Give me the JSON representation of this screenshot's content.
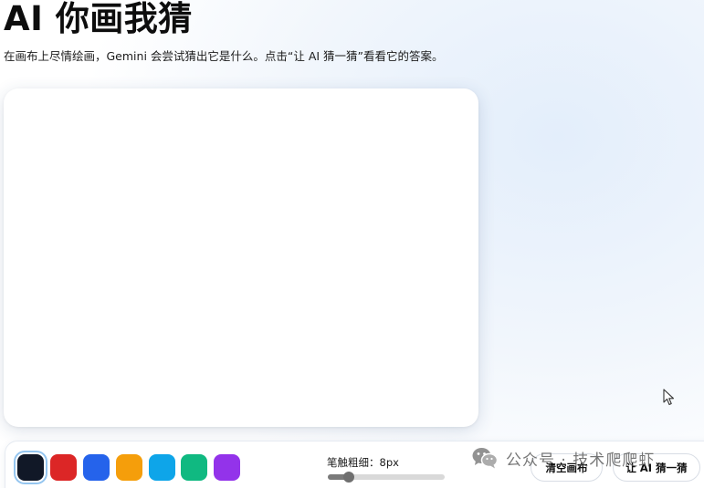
{
  "header": {
    "title": "AI 你画我猜",
    "subtitle": "在画布上尽情绘画，Gemini 会尝试猜出它是什么。点击“让 AI 猜一猜”看看它的答案。"
  },
  "palette": {
    "colors": [
      {
        "name": "black",
        "hex": "#111827",
        "selected": true
      },
      {
        "name": "red",
        "hex": "#dc2626",
        "selected": false
      },
      {
        "name": "blue",
        "hex": "#2563eb",
        "selected": false
      },
      {
        "name": "orange",
        "hex": "#f59e0b",
        "selected": false
      },
      {
        "name": "sky",
        "hex": "#0ea5e9",
        "selected": false
      },
      {
        "name": "green",
        "hex": "#10b981",
        "selected": false
      },
      {
        "name": "purple",
        "hex": "#9333ea",
        "selected": false
      }
    ]
  },
  "brush": {
    "label": "笔触粗细：8px",
    "size": 8,
    "min": 1,
    "max": 40
  },
  "actions": {
    "clear_label": "清空画布",
    "guess_label": "让 AI 猜一猜"
  },
  "watermark": {
    "text": "公众号 · 技术爬爬虾",
    "icon": "wechat-icon"
  }
}
